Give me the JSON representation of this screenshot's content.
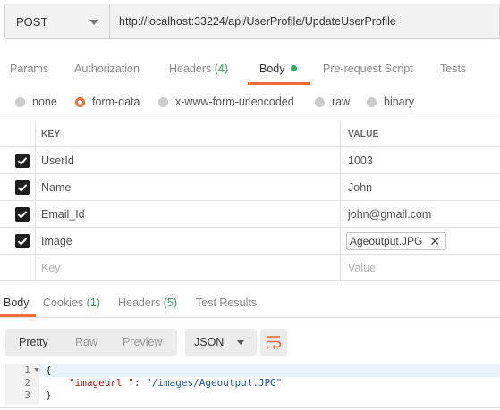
{
  "request": {
    "method": "POST",
    "url": "http://localhost:33224/api/UserProfile/UpdateUserProfile"
  },
  "request_tabs": {
    "params": "Params",
    "authorization": "Authorization",
    "headers": "Headers",
    "headers_count": "(4)",
    "body": "Body",
    "prerequest": "Pre-request Script",
    "tests": "Tests"
  },
  "body_types": {
    "none": "none",
    "form_data": "form-data",
    "urlencoded": "x-www-form-urlencoded",
    "raw": "raw",
    "binary": "binary",
    "selected": "form-data"
  },
  "form_table": {
    "key_header": "KEY",
    "value_header": "VALUE",
    "rows": [
      {
        "key": "UserId",
        "value": "1003",
        "checked": true
      },
      {
        "key": "Name",
        "value": "John",
        "checked": true
      },
      {
        "key": "Email_Id",
        "value": "john@gmail.com",
        "checked": true
      },
      {
        "key": "Image",
        "value": "Ageoutput.JPG",
        "checked": true,
        "type": "file"
      }
    ],
    "placeholder_key": "Key",
    "placeholder_value": "Value"
  },
  "response_tabs": {
    "body": "Body",
    "cookies": "Cookies",
    "cookies_count": "(1)",
    "headers": "Headers",
    "headers_count": "(5)",
    "test_results": "Test Results"
  },
  "response_toolbar": {
    "pretty": "Pretty",
    "raw": "Raw",
    "preview": "Preview",
    "format": "JSON"
  },
  "response_body": {
    "line_numbers": [
      "1",
      "2",
      "3"
    ],
    "open_brace": "{",
    "key": "\"imageurl \"",
    "colon": ": ",
    "value": "\"/images/Ageoutput.JPG\"",
    "close_brace": "}"
  },
  "colors": {
    "accent": "#f26b3a",
    "count_green": "#3aa55c",
    "dot_green": "#27ae60"
  }
}
